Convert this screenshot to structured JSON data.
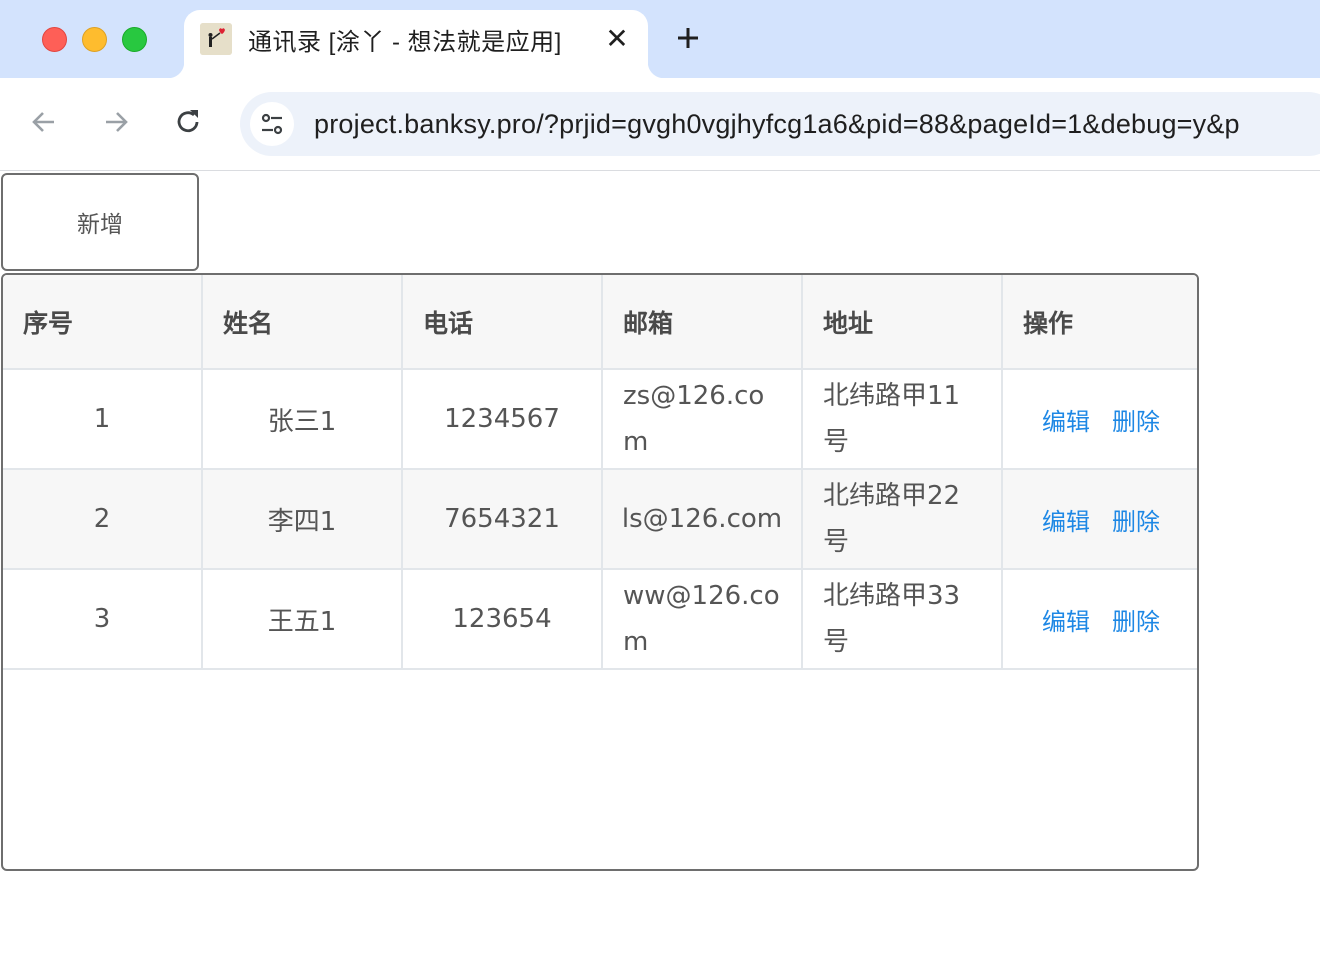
{
  "browser": {
    "tab_title": "通讯录 [涂丫 - 想法就是应用]",
    "tab_close": "✕",
    "url": "project.banksy.pro/?prjid=gvgh0vgjhyfcg1a6&pid=88&pageId=1&debug=y&p"
  },
  "page": {
    "add_button": "新增",
    "table": {
      "headers": [
        "序号",
        "姓名",
        "电话",
        "邮箱",
        "地址",
        "操作"
      ],
      "rows": [
        {
          "index": "1",
          "name": "张三1",
          "phone": "1234567",
          "email": "zs@126.com",
          "address": "北纬路甲11号",
          "edit": "编辑",
          "delete": "删除"
        },
        {
          "index": "2",
          "name": "李四1",
          "phone": "7654321",
          "email": "ls@126.com",
          "address": "北纬路甲22号",
          "edit": "编辑",
          "delete": "删除"
        },
        {
          "index": "3",
          "name": "王五1",
          "phone": "123654",
          "email": "ww@126.com",
          "address": "北纬路甲33号",
          "edit": "编辑",
          "delete": "删除"
        }
      ]
    }
  },
  "colors": {
    "tabbar_bg": "#d3e3fd",
    "omnibox_bg": "#edf2fa",
    "link": "#1e88e5",
    "table_border": "#6e6e6e"
  }
}
